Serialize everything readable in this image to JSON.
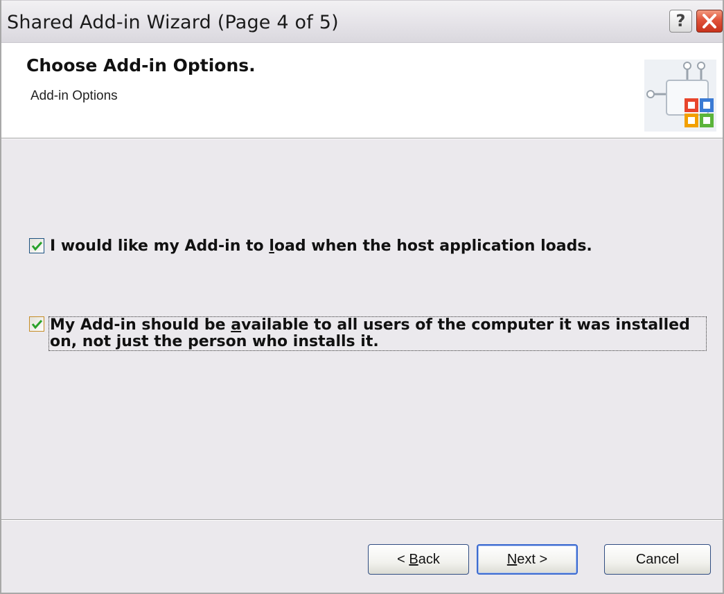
{
  "window": {
    "title": "Shared Add-in Wizard (Page 4 of 5)",
    "help_label": "?"
  },
  "header": {
    "title": "Choose Add-in Options.",
    "subtitle": "Add-in Options",
    "icon": "office-addin-icon"
  },
  "options": [
    {
      "checked": true,
      "pre": "I would like my Add-in to ",
      "accel": "l",
      "post": "oad when the host application loads."
    },
    {
      "checked": true,
      "pre": "My Add-in should be ",
      "accel": "a",
      "post": "vailable to all users of the computer it was installed on, not just the person who installs it."
    }
  ],
  "buttons": {
    "back": {
      "pre": "< ",
      "accel": "B",
      "post": "ack"
    },
    "next": {
      "pre": "",
      "accel": "N",
      "post": "ext >"
    },
    "cancel": "Cancel"
  },
  "colors": {
    "close_button": "#d9472d",
    "check": "#2aa22a",
    "focus_ring": "#3c6bd0"
  }
}
